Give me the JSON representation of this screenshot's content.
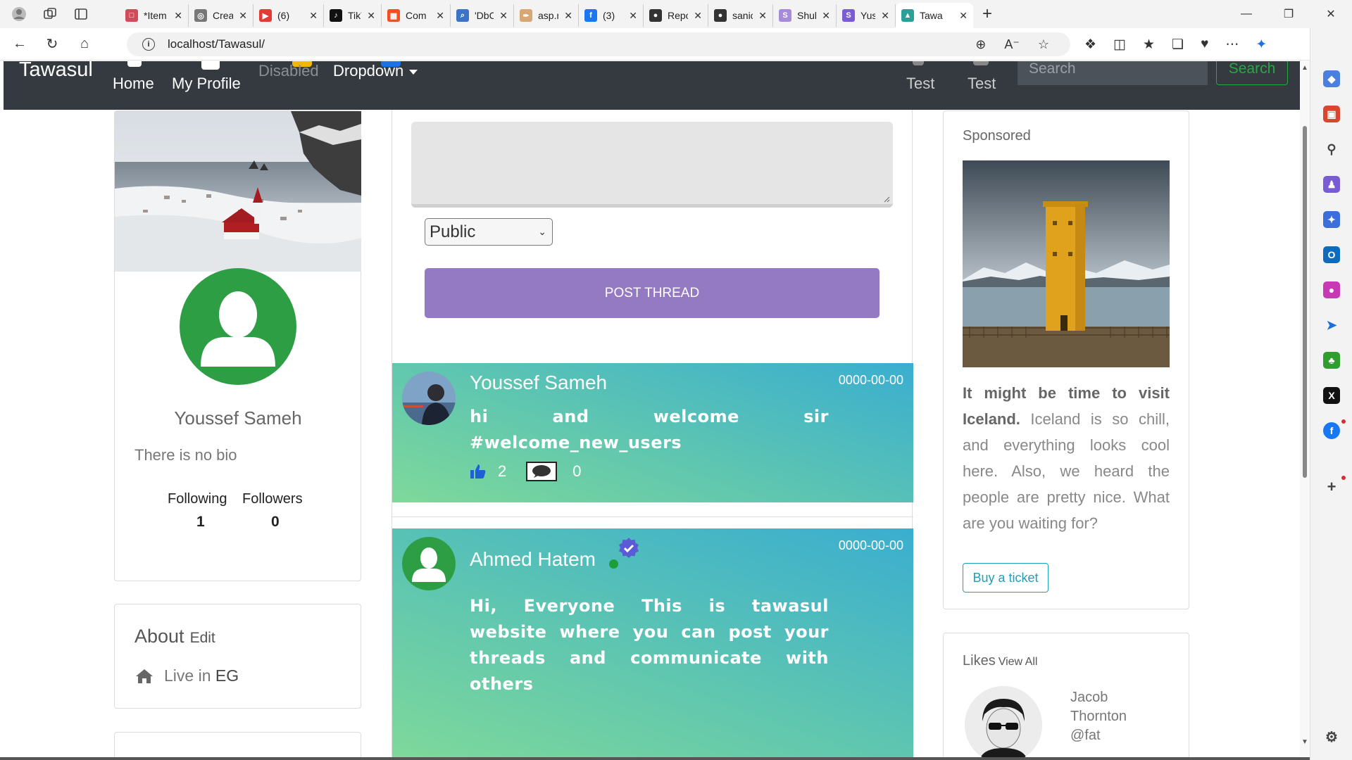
{
  "browser": {
    "tabs": [
      {
        "title": "*Item",
        "color": "#d14b5a",
        "glyph": "□"
      },
      {
        "title": "Creat",
        "color": "#777777",
        "glyph": "◎"
      },
      {
        "title": "(6)",
        "color": "#e53935",
        "glyph": "▶"
      },
      {
        "title": "TikTo",
        "color": "#111111",
        "glyph": "♪"
      },
      {
        "title": "Com",
        "color": "#f25022",
        "glyph": "▦"
      },
      {
        "title": "'DbC",
        "color": "#3b73c9",
        "glyph": "⌕"
      },
      {
        "title": "asp.r",
        "color": "#d9a774",
        "glyph": "✒"
      },
      {
        "title": "(3)",
        "color": "#1877f2",
        "glyph": "f"
      },
      {
        "title": "Repo",
        "color": "#333333",
        "glyph": "●"
      },
      {
        "title": "sanic",
        "color": "#333333",
        "glyph": "●"
      },
      {
        "title": "Shub",
        "color": "#a78bdb",
        "glyph": "S"
      },
      {
        "title": "Yusu",
        "color": "#7b5bd6",
        "glyph": "S"
      },
      {
        "title": "Tawa",
        "color": "#2aa198",
        "glyph": "▲"
      }
    ],
    "url": "localhost/Tawasul/"
  },
  "navbar": {
    "brand": "Tawasul",
    "home": "Home",
    "profile": "My Profile",
    "disabled": "Disabled",
    "dropdown": "Dropdown",
    "test1": "Test",
    "test2": "Test",
    "search_placeholder": "Search",
    "search_button": "Search"
  },
  "profile": {
    "name": "Youssef Sameh",
    "bio": "There is no bio",
    "following_label": "Following",
    "followers_label": "Followers",
    "following": "1",
    "followers": "0"
  },
  "about": {
    "title": "About",
    "edit": "Edit",
    "live_label": "Live in",
    "live_value": "EG"
  },
  "composer": {
    "privacy": "Public",
    "post_button": "POST THREAD"
  },
  "threads": [
    {
      "author": "Youssef Sameh",
      "date": "0000-00-00",
      "body": "hi and welcome sir",
      "body_last": "#welcome_new_users",
      "likes": "2",
      "comments": "0"
    },
    {
      "author": "Ahmed Hatem",
      "date": "0000-00-00",
      "body": "Hi, Everyone This is tawasul website where you can post your threads and communicate with",
      "body_last": "others"
    }
  ],
  "sponsored": {
    "title": "Sponsored",
    "text_bold": "It might be time to visit Iceland.",
    "text_rest": " Iceland is so chill, and everything looks cool here. Also, we heard the people are pretty nice. What are you waiting for?",
    "button": "Buy a ticket"
  },
  "likes": {
    "title": "Likes",
    "view_all": "View All",
    "person_first": "Jacob",
    "person_last": "Thornton",
    "person_handle": "@fat"
  }
}
